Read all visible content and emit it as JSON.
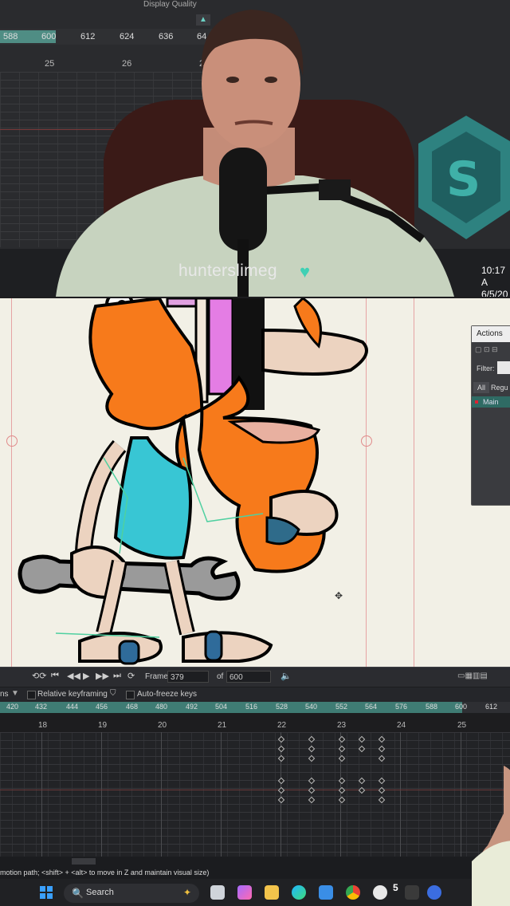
{
  "top_timeline": {
    "display_quality_label": "Display Quality",
    "ruler": [
      "588",
      "600",
      "612",
      "624",
      "636",
      "64"
    ],
    "seconds": [
      "25",
      "26",
      "2"
    ]
  },
  "stream": {
    "username": "hunterslimeg",
    "heart_icon": "heart-icon",
    "clock_time": "10:17 A",
    "clock_date": "6/5/20"
  },
  "actions_panel": {
    "title": "Actions",
    "filter_label": "Filter:",
    "tab_all": "All",
    "tab_regular": "Regu",
    "item_main": "Main"
  },
  "playback": {
    "frame_label": "Frame",
    "frame_value": "379",
    "of_label": "of",
    "total_frames": "600"
  },
  "options": {
    "partial_label": "ns",
    "relative_keyframing": "Relative keyframing",
    "auto_freeze_keys": "Auto-freeze keys"
  },
  "frame_ruler": [
    "420",
    "432",
    "444",
    "456",
    "468",
    "480",
    "492",
    "504",
    "516",
    "528",
    "540",
    "552",
    "564",
    "576",
    "588",
    "600",
    "612"
  ],
  "seconds_row": [
    "18",
    "19",
    "20",
    "21",
    "22",
    "23",
    "24",
    "25"
  ],
  "status_text": "motion path; <shift> + <alt> to move in Z and maintain visual size)",
  "taskbar": {
    "search_label": "Search",
    "badge_count": "5"
  },
  "colors": {
    "accent": "#4f8d84",
    "canvas_bg": "#f2f0e6",
    "hair": "#f77a1b",
    "tank_top": "#38c6d4",
    "skin": "#ecd3c0"
  }
}
